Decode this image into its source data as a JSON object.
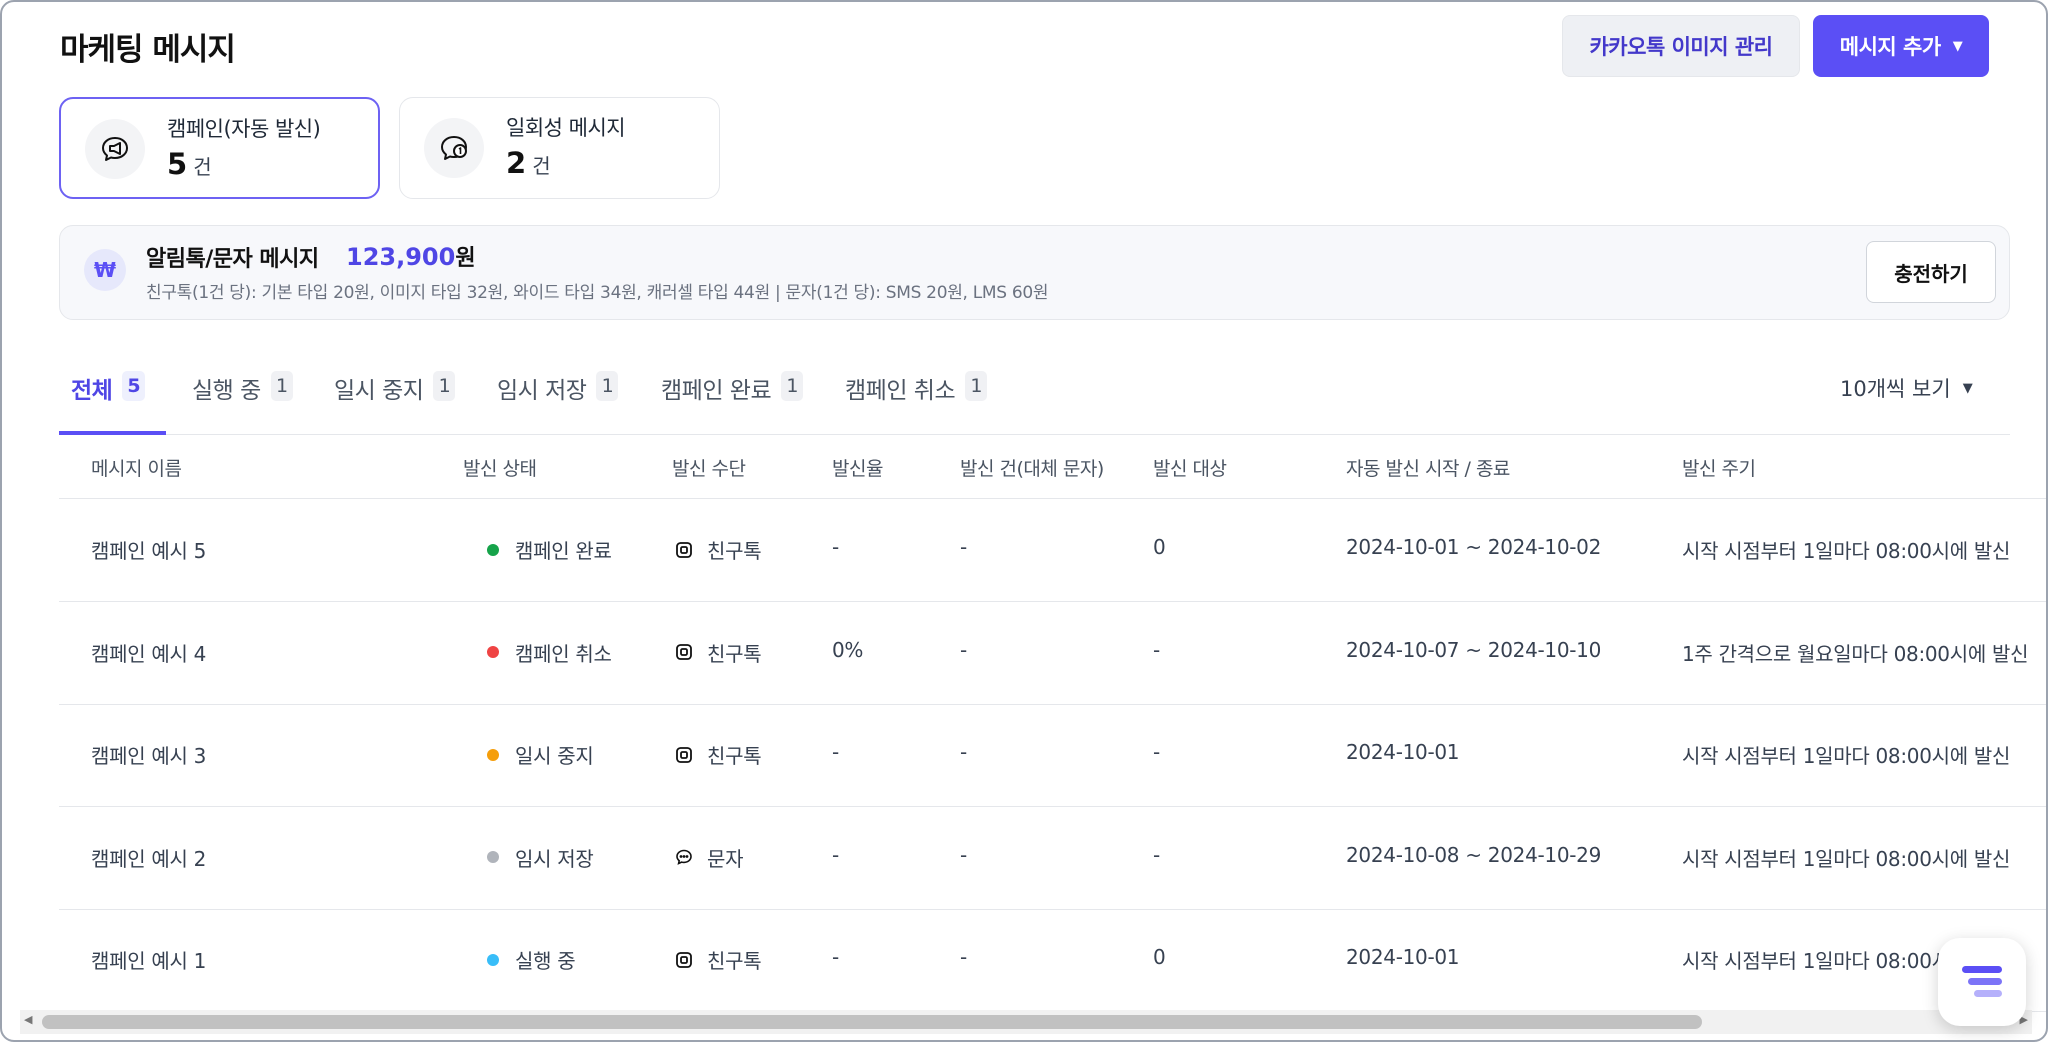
{
  "header": {
    "title": "마케팅 메시지",
    "kakao_button": "카카오톡 이미지 관리",
    "add_button": "메시지 추가"
  },
  "stats": [
    {
      "label": "캠페인(자동 발신)",
      "count": "5",
      "unit": "건",
      "icon": "megaphone-chat-icon"
    },
    {
      "label": "일회성 메시지",
      "count": "2",
      "unit": "건",
      "icon": "chat-one-icon"
    }
  ],
  "balance": {
    "icon": "₩",
    "title": "알림톡/문자 메시지",
    "amount": "123,900",
    "amount_unit": "원",
    "description": "친구톡(1건 당): 기본 타입 20원, 이미지 타입 32원, 와이드 타입 34원, 캐러셀 타입 44원 | 문자(1건 당): SMS 20원, LMS 60원",
    "charge_button": "충전하기"
  },
  "tabs": [
    {
      "label": "전체",
      "count": "5",
      "active": true
    },
    {
      "label": "실행 중",
      "count": "1"
    },
    {
      "label": "일시 중지",
      "count": "1"
    },
    {
      "label": "임시 저장",
      "count": "1"
    },
    {
      "label": "캠페인 완료",
      "count": "1"
    },
    {
      "label": "캠페인 취소",
      "count": "1"
    }
  ],
  "per_page": "10개씩 보기",
  "table": {
    "columns": [
      "메시지 이름",
      "발신 상태",
      "발신 수단",
      "발신율",
      "발신 건(대체 문자)",
      "발신 대상",
      "자동 발신 시작 / 종료",
      "발신 주기"
    ],
    "rows": [
      {
        "name": "캠페인 예시 5",
        "status": "캠페인 완료",
        "status_color": "#16a34a",
        "channel": "친구톡",
        "channel_icon": "friendtalk-icon",
        "rate": "-",
        "sent": "-",
        "target": "0",
        "period": "2024-10-01 ~ 2024-10-02",
        "cycle": "시작 시점부터 1일마다 08:00시에 발신"
      },
      {
        "name": "캠페인 예시 4",
        "status": "캠페인 취소",
        "status_color": "#ef4444",
        "channel": "친구톡",
        "channel_icon": "friendtalk-icon",
        "rate": "0%",
        "sent": "-",
        "target": "-",
        "period": "2024-10-07 ~ 2024-10-10",
        "cycle": "1주 간격으로 월요일마다 08:00시에 발신"
      },
      {
        "name": "캠페인 예시 3",
        "status": "일시 중지",
        "status_color": "#f59e0b",
        "channel": "친구톡",
        "channel_icon": "friendtalk-icon",
        "rate": "-",
        "sent": "-",
        "target": "-",
        "period": "2024-10-01",
        "cycle": "시작 시점부터 1일마다 08:00시에 발신"
      },
      {
        "name": "캠페인 예시 2",
        "status": "임시 저장",
        "status_color": "#b0b4bb",
        "channel": "문자",
        "channel_icon": "sms-icon",
        "rate": "-",
        "sent": "-",
        "target": "-",
        "period": "2024-10-08 ~ 2024-10-29",
        "cycle": "시작 시점부터 1일마다 08:00시에 발신"
      },
      {
        "name": "캠페인 예시 1",
        "status": "실행 중",
        "status_color": "#38bdf8",
        "channel": "친구톡",
        "channel_icon": "friendtalk-icon",
        "rate": "-",
        "sent": "-",
        "target": "0",
        "period": "2024-10-01",
        "cycle": "시작 시점부터 1일마다 08:00시에 발신"
      }
    ]
  },
  "colors": {
    "accent": "#5b4ff5",
    "accent_text": "#4f46e5"
  }
}
